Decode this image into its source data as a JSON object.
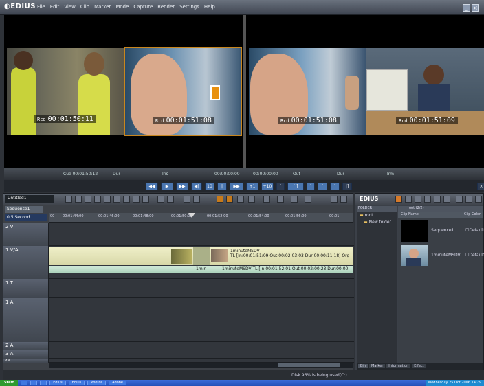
{
  "app": {
    "name": "EDIUS",
    "menu": [
      "File",
      "Edit",
      "View",
      "Clip",
      "Marker",
      "Mode",
      "Capture",
      "Render",
      "Settings",
      "Help"
    ]
  },
  "preview": {
    "left_timecodes": [
      "00:01:50:11",
      "00:01:51:08"
    ],
    "right_timecodes": [
      "00:01:51:08",
      "00:01:51:09"
    ],
    "tc_prefix": "Rcd"
  },
  "tcbar": {
    "cue": "Cue 00:01:50:12",
    "labels": [
      "Dur",
      "Ins",
      "Out",
      "Dur",
      "Trm"
    ],
    "in": "00:00:00:00",
    "out": "00:00:00:00"
  },
  "timeline": {
    "project": "Untitled1",
    "sequence": "Sequence1",
    "scale": "0.5 Second",
    "ruler": [
      "00",
      "00:01:44:00",
      "00:01:46:00",
      "00:01:48:00",
      "00:01:50:00",
      "00:01:52:00",
      "00:01:54:00",
      "00:01:56:00",
      "00:01"
    ],
    "tracks": [
      "2 V",
      "1 V/A",
      "1 T",
      "1 A",
      "2 A",
      "3 A",
      "4 A"
    ],
    "clip_name": "1minuteMSDV",
    "clip_info": "TL [In:00:01:51:09 Out:00:02:03:03 Dur:00:00:11:18] Org",
    "audio_short": "1min",
    "audio_info": "1minuteMSDV  TL [In:00:01:52:01 Out:00:02:00:23 Dur:00:00"
  },
  "bin": {
    "title": "EDIUS",
    "folder_label": "FOLDER",
    "path": "root (2/2)",
    "root": "root",
    "new_folder": "New folder",
    "col_name": "Clip Name",
    "col_color": "Clip Color",
    "items": [
      {
        "name": "Sequence1",
        "color": "Default"
      },
      {
        "name": "1minuteMSDV",
        "color": "Default"
      }
    ],
    "tabs": [
      "Bin",
      "Marker",
      "Information",
      "Effect"
    ]
  },
  "status": {
    "disk": "Disk 96% is being used(C:)"
  },
  "taskbar": {
    "start": "Start",
    "items": [
      "",
      "",
      "",
      "Edius",
      "Edius",
      "Photos",
      "",
      "Adobe",
      ""
    ],
    "clock": "Wednesday 25 Oct 2006 14:29"
  },
  "colors": {
    "accent": "#e8900f",
    "bar": "#4a76b0"
  }
}
